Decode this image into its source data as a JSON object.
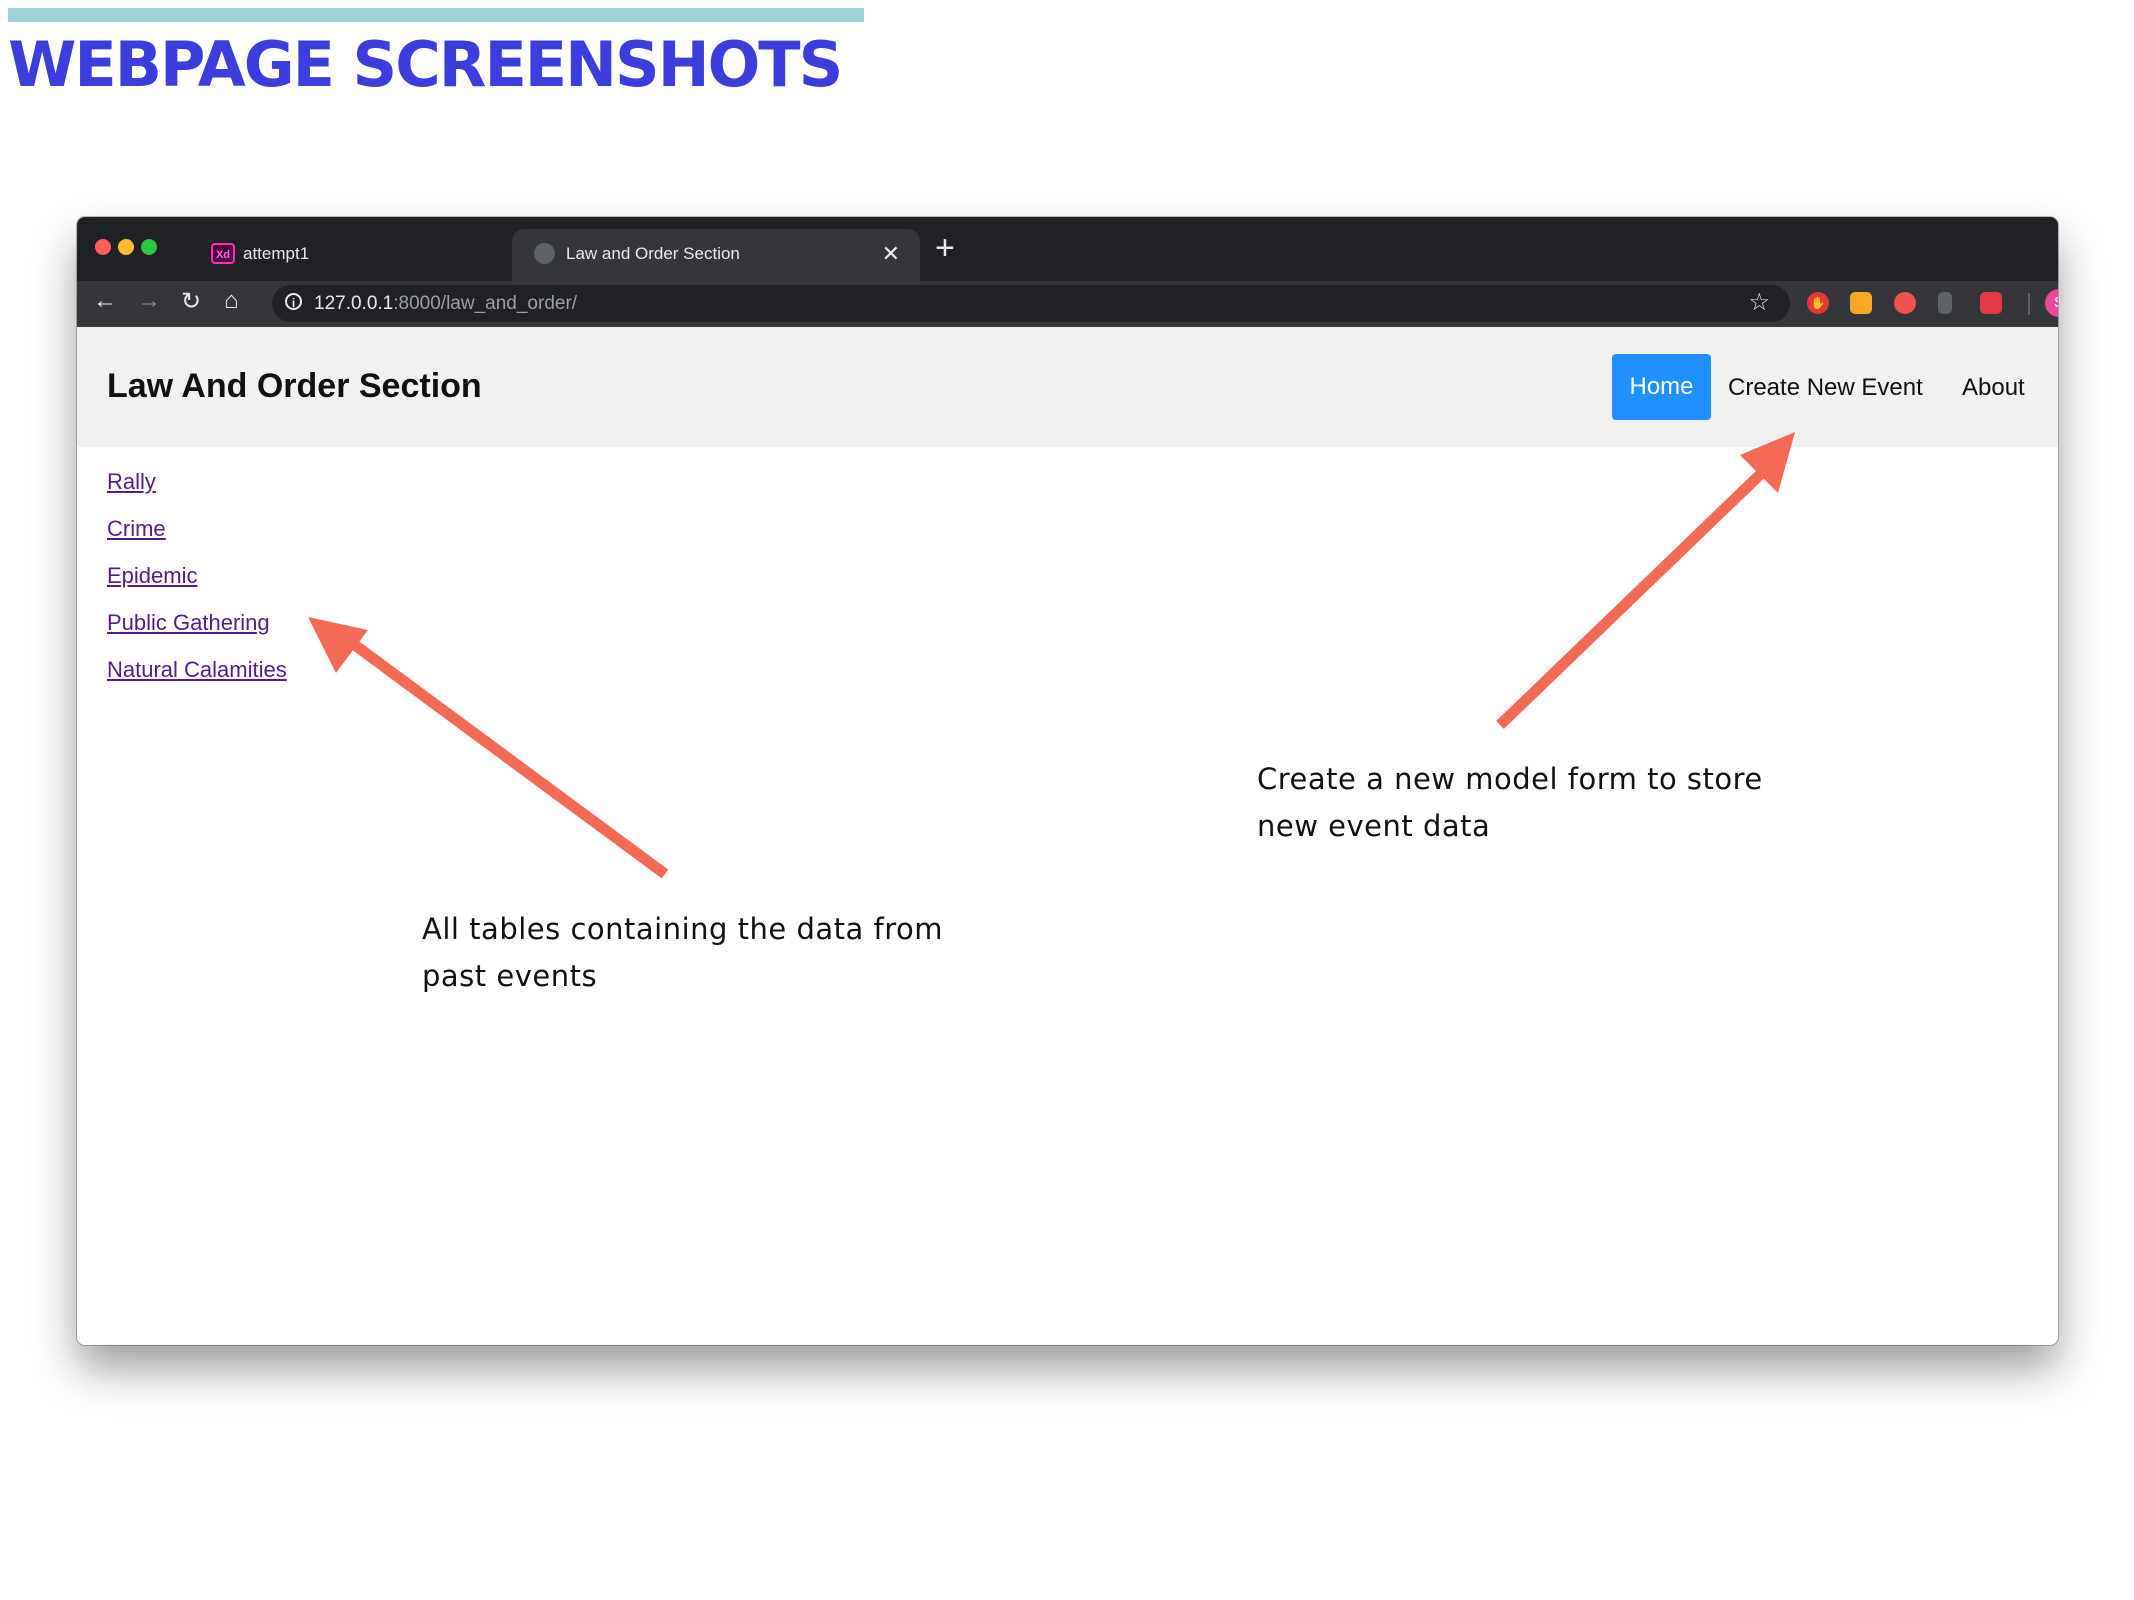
{
  "slide": {
    "title": "WEBPAGE SCREENSHOTS",
    "accent_color": "#9ed3d6",
    "title_color": "#3b3ddc"
  },
  "browser": {
    "tabs": [
      {
        "title": "attempt1",
        "favicon": "xd-icon",
        "favicon_text": "Xd",
        "active": false
      },
      {
        "title": "Law and Order Section",
        "favicon": "globe-icon",
        "active": true
      }
    ],
    "url_host": "127.0.0.1",
    "url_path": ":8000/law_and_order/",
    "profile_initial": "S"
  },
  "site": {
    "brand": "Law And Order Section",
    "nav": {
      "home": "Home",
      "create": "Create New Event",
      "about": "About"
    },
    "accent_color": "#1e90ff",
    "categories": [
      "Rally",
      "Crime",
      "Epidemic",
      "Public Gathering",
      "Natural Calamities"
    ]
  },
  "annotations": {
    "left_line1": "All tables containing the data from",
    "left_line2": "past events",
    "right_line1": "Create a new model form to store",
    "right_line2": "new event data",
    "arrow_color": "#f56a55"
  }
}
